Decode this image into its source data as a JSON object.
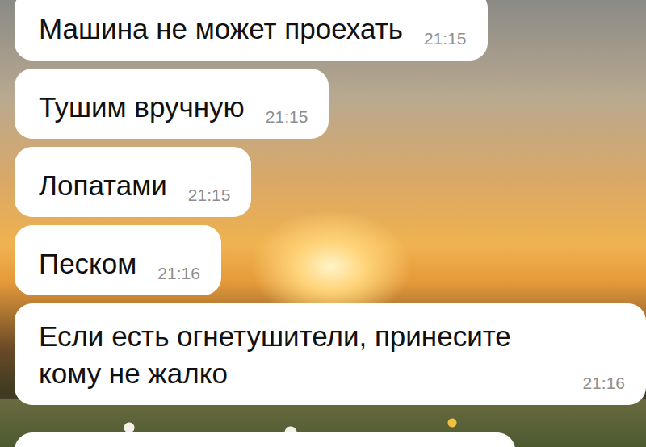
{
  "messages": [
    {
      "text": "Машина не может проехать",
      "time": "21:15"
    },
    {
      "text": "Тушим вручную",
      "time": "21:15"
    },
    {
      "text": "Лопатами",
      "time": "21:15"
    },
    {
      "text": "Песком",
      "time": "21:16"
    },
    {
      "text": "Если есть огнетушители, принесите кому не жалко",
      "time": "21:16"
    }
  ]
}
